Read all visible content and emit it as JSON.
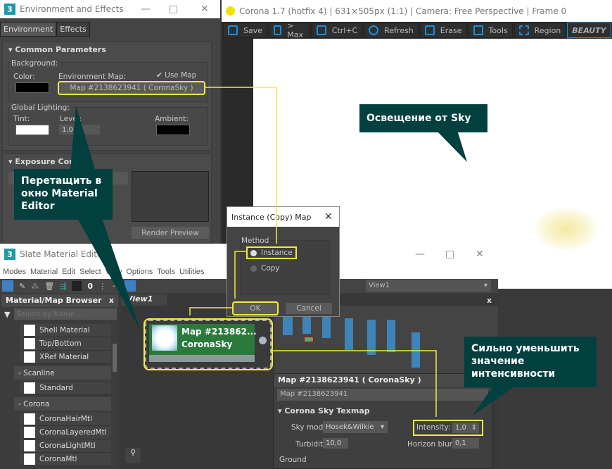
{
  "env": {
    "title": "Environment and Effects",
    "tabs": [
      "Environment",
      "Effects"
    ],
    "common_params": "Common Parameters",
    "background": "Background:",
    "color": "Color:",
    "env_map": "Environment Map:",
    "use_map": "Use Map",
    "map_button": "Map #2138623941  ( CoronaSky )",
    "global_lighting": "Global Lighting:",
    "tint": "Tint:",
    "level": "Level:",
    "level_value": "1,0",
    "ambient": "Ambient:",
    "exposure": "Exposure Control",
    "render_preview": "Render Preview"
  },
  "corona": {
    "title": "Corona 1.7 (hotfix 4) | 631×505px (1:1) | Camera: Free Perspective | Frame 0",
    "toolbar": [
      "Save",
      "> Max",
      "Ctrl+C",
      "Refresh",
      "Erase",
      "Tools",
      "Region"
    ],
    "channel": "BEAUTY"
  },
  "dialog": {
    "title": "Instance (Copy) Map",
    "method": "Method",
    "options": [
      "Instance",
      "Copy"
    ],
    "selected": "Instance",
    "ok": "OK",
    "cancel": "Cancel"
  },
  "slate": {
    "title": "Slate Material Editor",
    "menu": [
      "Modes",
      "Material",
      "Edit",
      "Select",
      "View",
      "Options",
      "Tools",
      "Utilities"
    ],
    "view_select": "View1",
    "browser_title": "Material/Map Browser",
    "search_placeholder": "Search by Name ...",
    "items_top": [
      "Shell Material",
      "Top/Bottom",
      "XRef Material"
    ],
    "cat_scanline": "- Scanline",
    "items_scanline": [
      "Standard"
    ],
    "cat_corona": "- Corona",
    "items_corona": [
      "CoronaHairMtl",
      "CoronaLayeredMtl",
      "CoronaLightMtl",
      "CoronaMtl"
    ],
    "view_tab": "View1",
    "node_name": "Map #213862...",
    "node_type": "CoronaSky"
  },
  "params": {
    "header": "Map #2138623941  ( CoronaSky )",
    "name_field": "Map #2138623941",
    "rollout": "Corona Sky Texmap",
    "sky_model_label": "Sky model:",
    "sky_model": "Hosek&Wilkie",
    "intensity_label": "Intensity:",
    "intensity": "1,0",
    "turbidity_label": "Turbidity:",
    "turbidity": "10,0",
    "horizon_label": "Horizon blur:",
    "horizon": "0,1",
    "ground": "Ground"
  },
  "callouts": {
    "sky": "Освещение от Sky",
    "drag": "Перетащить в окно Material Editor",
    "intensity": "Сильно уменьшить значение интенсивности"
  },
  "colors": {
    "highlight": "#f3ec3a",
    "callout": "#01403f",
    "node": "#2b7a3c"
  }
}
